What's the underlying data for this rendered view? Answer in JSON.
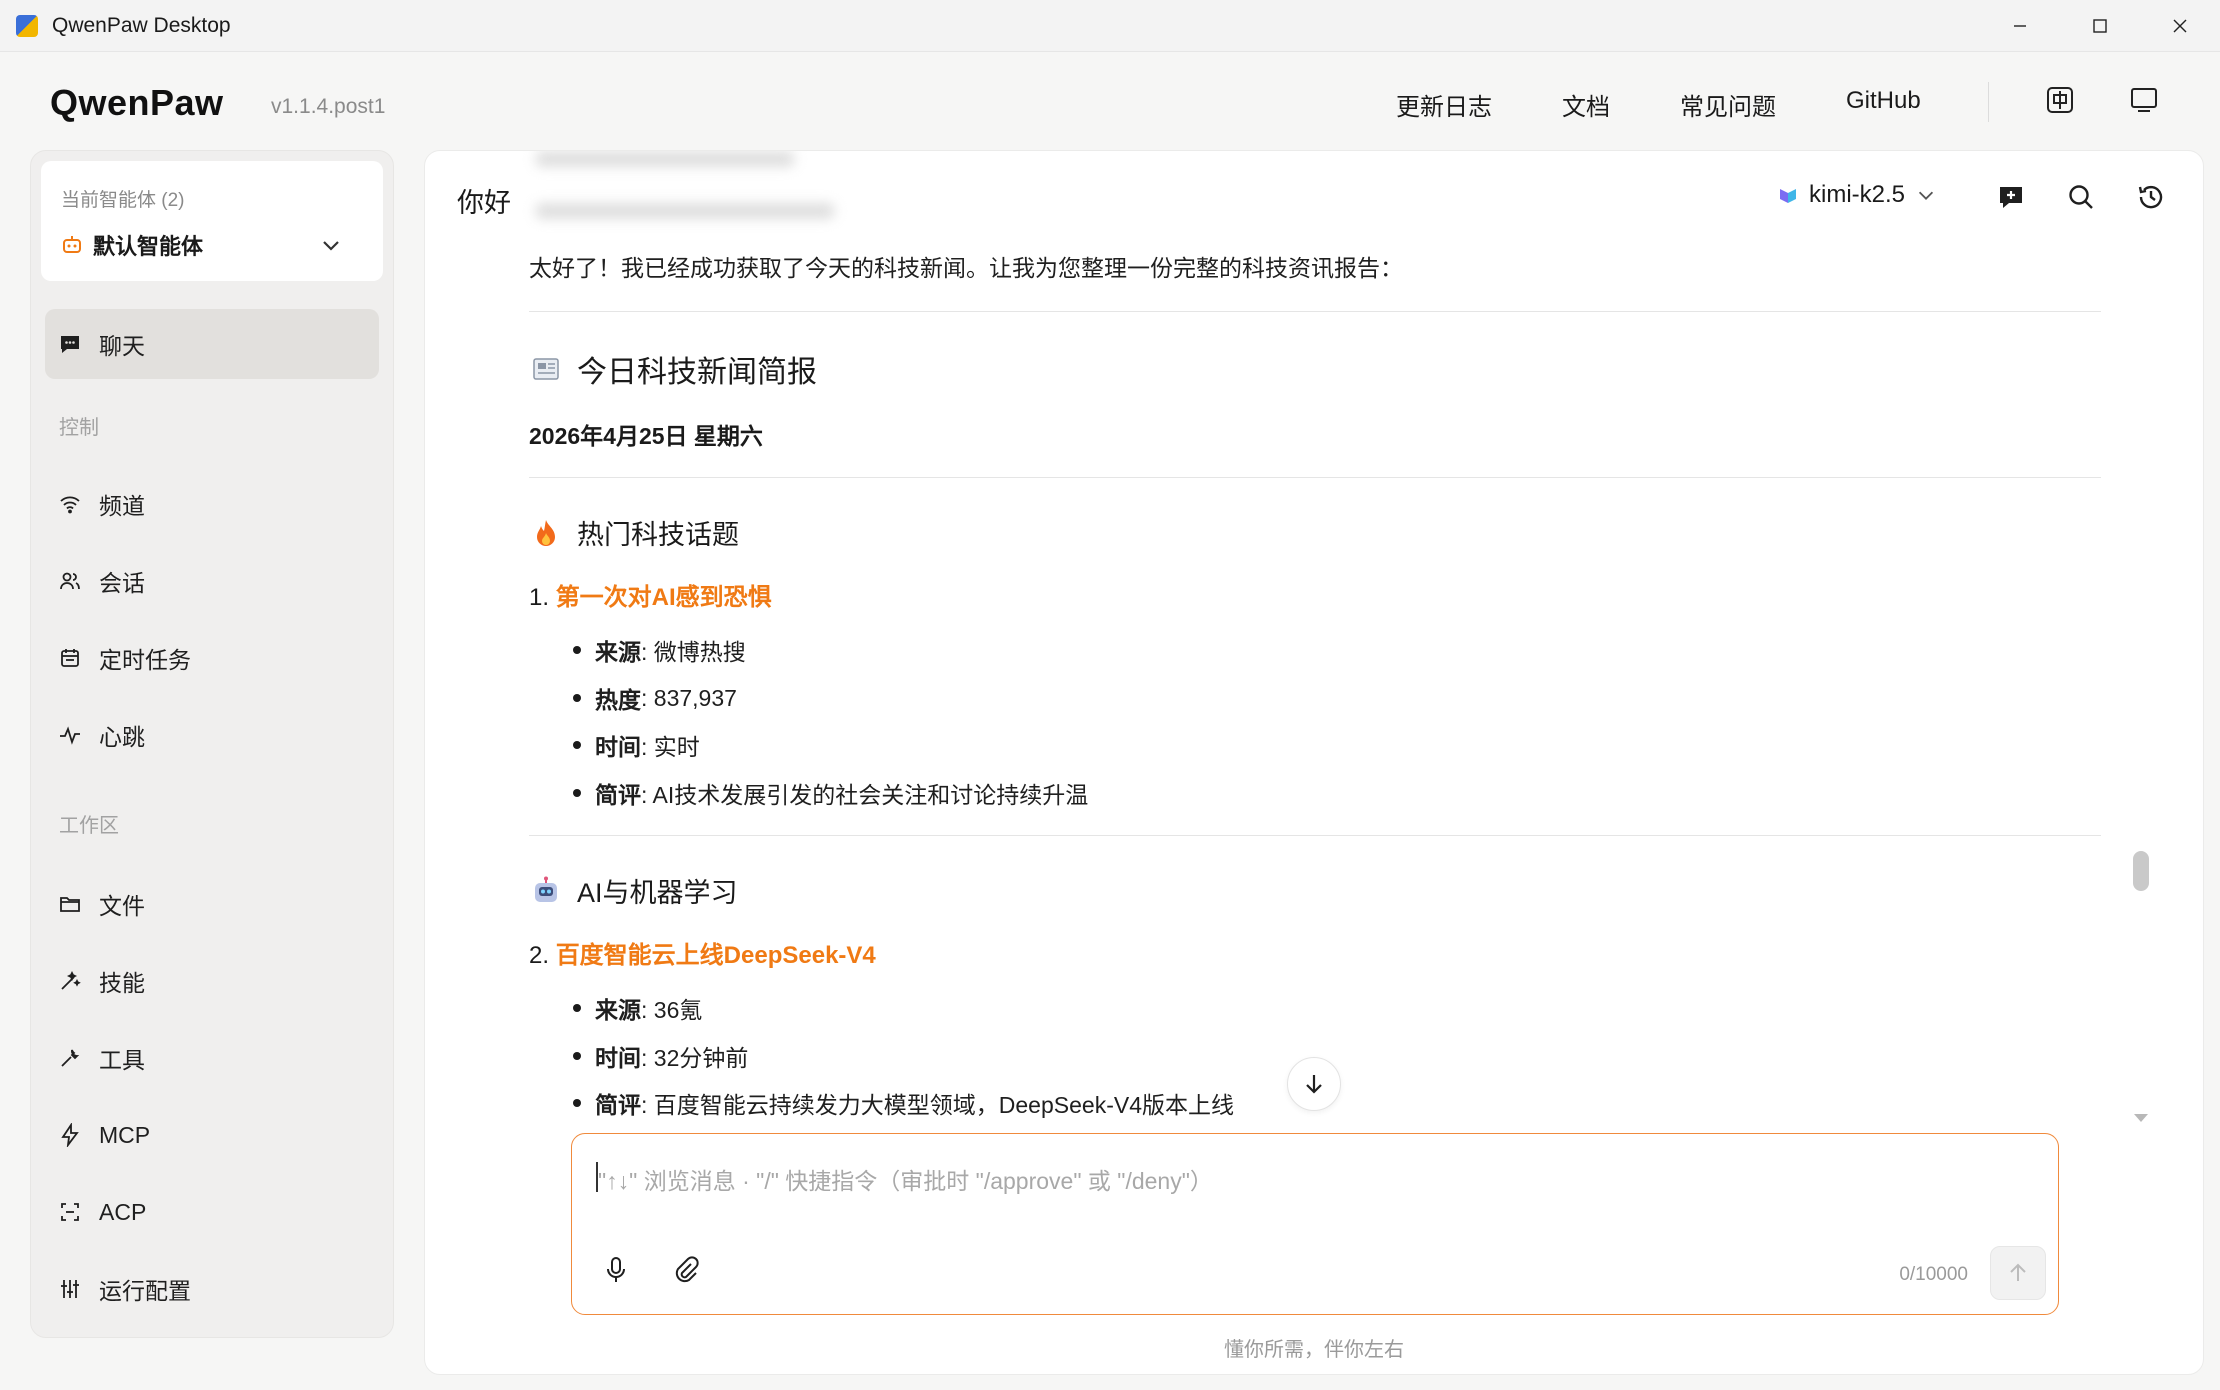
{
  "window": {
    "title": "QwenPaw Desktop"
  },
  "header": {
    "logo": "QwenPaw",
    "version": "v1.1.4.post1",
    "nav": [
      "更新日志",
      "文档",
      "常见问题",
      "GitHub"
    ]
  },
  "sidebar": {
    "agent_caption": "当前智能体 (2)",
    "agent_name": "默认智能体",
    "chat_label": "聊天",
    "section_control": "控制",
    "control_items": [
      "频道",
      "会话",
      "定时任务",
      "心跳"
    ],
    "section_workspace": "工作区",
    "workspace_items": [
      "文件",
      "技能",
      "工具",
      "MCP",
      "ACP",
      "运行配置"
    ]
  },
  "chat": {
    "title": "你好",
    "model": "kimi-k2.5",
    "intro": "太好了！我已经成功获取了今天的科技新闻。让我为您整理一份完整的科技资讯报告：",
    "heading": "今日科技新闻简报",
    "date": "2026年4月25日 星期六",
    "sections": [
      {
        "title": "热门科技话题",
        "item_num": "1.",
        "item_title": "第一次对AI感到恐惧",
        "bullets": [
          {
            "k": "来源",
            "v": ": 微博热搜"
          },
          {
            "k": "热度",
            "v": ": 837,937"
          },
          {
            "k": "时间",
            "v": ": 实时"
          },
          {
            "k": "简评",
            "v": ": AI技术发展引发的社会关注和讨论持续升温"
          }
        ]
      },
      {
        "title": "AI与机器学习",
        "item_num": "2.",
        "item_title": "百度智能云上线DeepSeek-V4",
        "bullets": [
          {
            "k": "来源",
            "v": ": 36氪"
          },
          {
            "k": "时间",
            "v": ": 32分钟前"
          },
          {
            "k": "简评",
            "v": ": 百度智能云持续发力大模型领域，DeepSeek-V4版本上线"
          }
        ]
      }
    ]
  },
  "composer": {
    "placeholder": "\"↑↓\" 浏览消息 · \"/\" 快捷指令（审批时 \"/approve\" 或 \"/deny\"）",
    "counter": "0/10000",
    "footer": "懂你所需，伴你左右"
  },
  "colors": {
    "accent": "#f07a14",
    "composer_border": "#f08a3c",
    "active_item_bg": "#e2e0dd"
  },
  "icons": {
    "chat": "chat-bubble-icon",
    "channel": "wifi-icon",
    "session": "people-icon",
    "cron": "calendar-icon",
    "heartbeat": "pulse-icon",
    "files": "folder-icon",
    "skills": "magic-wand-icon",
    "tools": "wrench-icon",
    "mcp": "bolt-icon",
    "acp": "scan-icon",
    "config": "sliders-icon"
  }
}
